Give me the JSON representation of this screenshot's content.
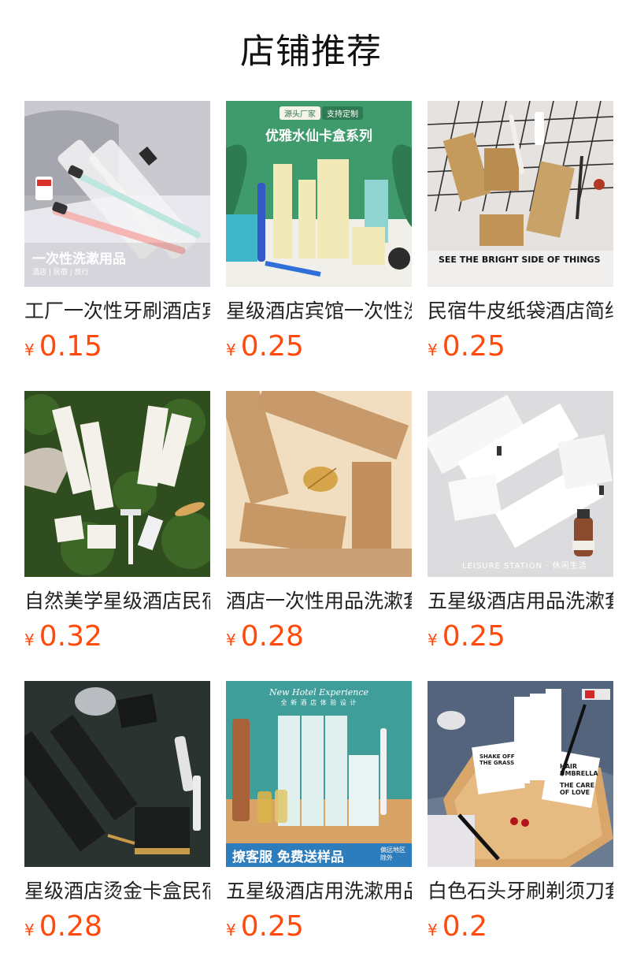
{
  "title": "店铺推荐",
  "currency_symbol": "¥",
  "colors": {
    "price": "#ff4a0a",
    "text": "#222222",
    "background": "#ffffff"
  },
  "products": [
    {
      "name": "工厂一次性牙刷酒店宾馆专用",
      "price": "0.15",
      "image_text": {
        "caption": "一次性洗漱用品",
        "sub": "酒店 | 民宿 | 旅行"
      }
    },
    {
      "name": "星级酒店宾馆一次性洗漱用品",
      "price": "0.25",
      "image_text": {
        "tag_left": "源头厂家",
        "tag_right": "支持定制",
        "caption": "优雅水仙卡盒系列"
      }
    },
    {
      "name": "民宿牛皮纸袋酒店简约套装",
      "price": "0.25",
      "image_text": {
        "caption": "SEE THE BRIGHT SIDE OF THINGS"
      }
    },
    {
      "name": "自然美学星级酒店民宿套装",
      "price": "0.32",
      "image_text": {}
    },
    {
      "name": "酒店一次性用品洗漱套装",
      "price": "0.28",
      "image_text": {}
    },
    {
      "name": "五星级酒店用品洗漱套装",
      "price": "0.25",
      "image_text": {
        "caption": "LEISURE STATION · 休闲生活"
      }
    },
    {
      "name": "星级酒店烫金卡盒民宿套装",
      "price": "0.28",
      "image_text": {}
    },
    {
      "name": "五星级酒店用洗漱用品",
      "price": "0.25",
      "image_text": {
        "header": "New Hotel Experience",
        "subheader": "全 新 酒 店 体 验 设 计",
        "banner": "撩客服 免费送样品",
        "badge": "偏远地区除外"
      }
    },
    {
      "name": "白色石头牙刷剃须刀套装",
      "price": "0.2",
      "image_text": {
        "label_a": "HAIR UMBRELLA",
        "label_b": "THE CARE OF LOVE",
        "label_c": "SHAKE OFF THE GRASS"
      }
    }
  ]
}
